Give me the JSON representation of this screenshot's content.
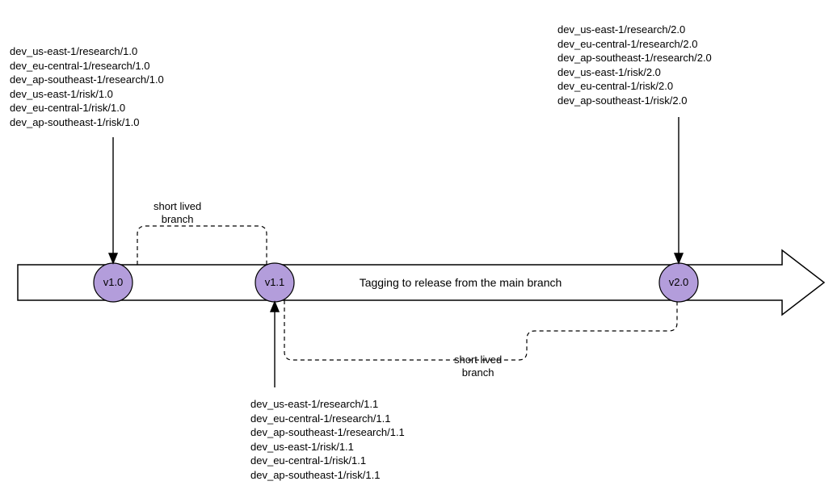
{
  "arrow": {
    "main_label": "Tagging to release from the main branch"
  },
  "short_lived_branch": {
    "label_1": "short lived",
    "label_1b": "branch",
    "label_2": "short lived",
    "label_2b": "branch"
  },
  "nodes": {
    "v10": {
      "label": "v1.0"
    },
    "v11": {
      "label": "v1.1"
    },
    "v20": {
      "label": "v2.0"
    }
  },
  "tags_v10": {
    "l0": "dev_us-east-1/research/1.0",
    "l1": "dev_eu-central-1/research/1.0",
    "l2": "dev_ap-southeast-1/research/1.0",
    "l3": "dev_us-east-1/risk/1.0",
    "l4": "dev_eu-central-1/risk/1.0",
    "l5": "dev_ap-southeast-1/risk/1.0"
  },
  "tags_v11": {
    "l0": "dev_us-east-1/research/1.1",
    "l1": "dev_eu-central-1/research/1.1",
    "l2": "dev_ap-southeast-1/research/1.1",
    "l3": "dev_us-east-1/risk/1.1",
    "l4": "dev_eu-central-1/risk/1.1",
    "l5": "dev_ap-southeast-1/risk/1.1"
  },
  "tags_v20": {
    "l0": "dev_us-east-1/research/2.0",
    "l1": "dev_eu-central-1/research/2.0",
    "l2": "dev_ap-southeast-1/research/2.0",
    "l3": "dev_us-east-1/risk/2.0",
    "l4": "dev_eu-central-1/risk/2.0",
    "l5": "dev_ap-southeast-1/risk/2.0"
  },
  "colors": {
    "node_fill": "#b39ddb",
    "node_stroke": "#000000"
  }
}
